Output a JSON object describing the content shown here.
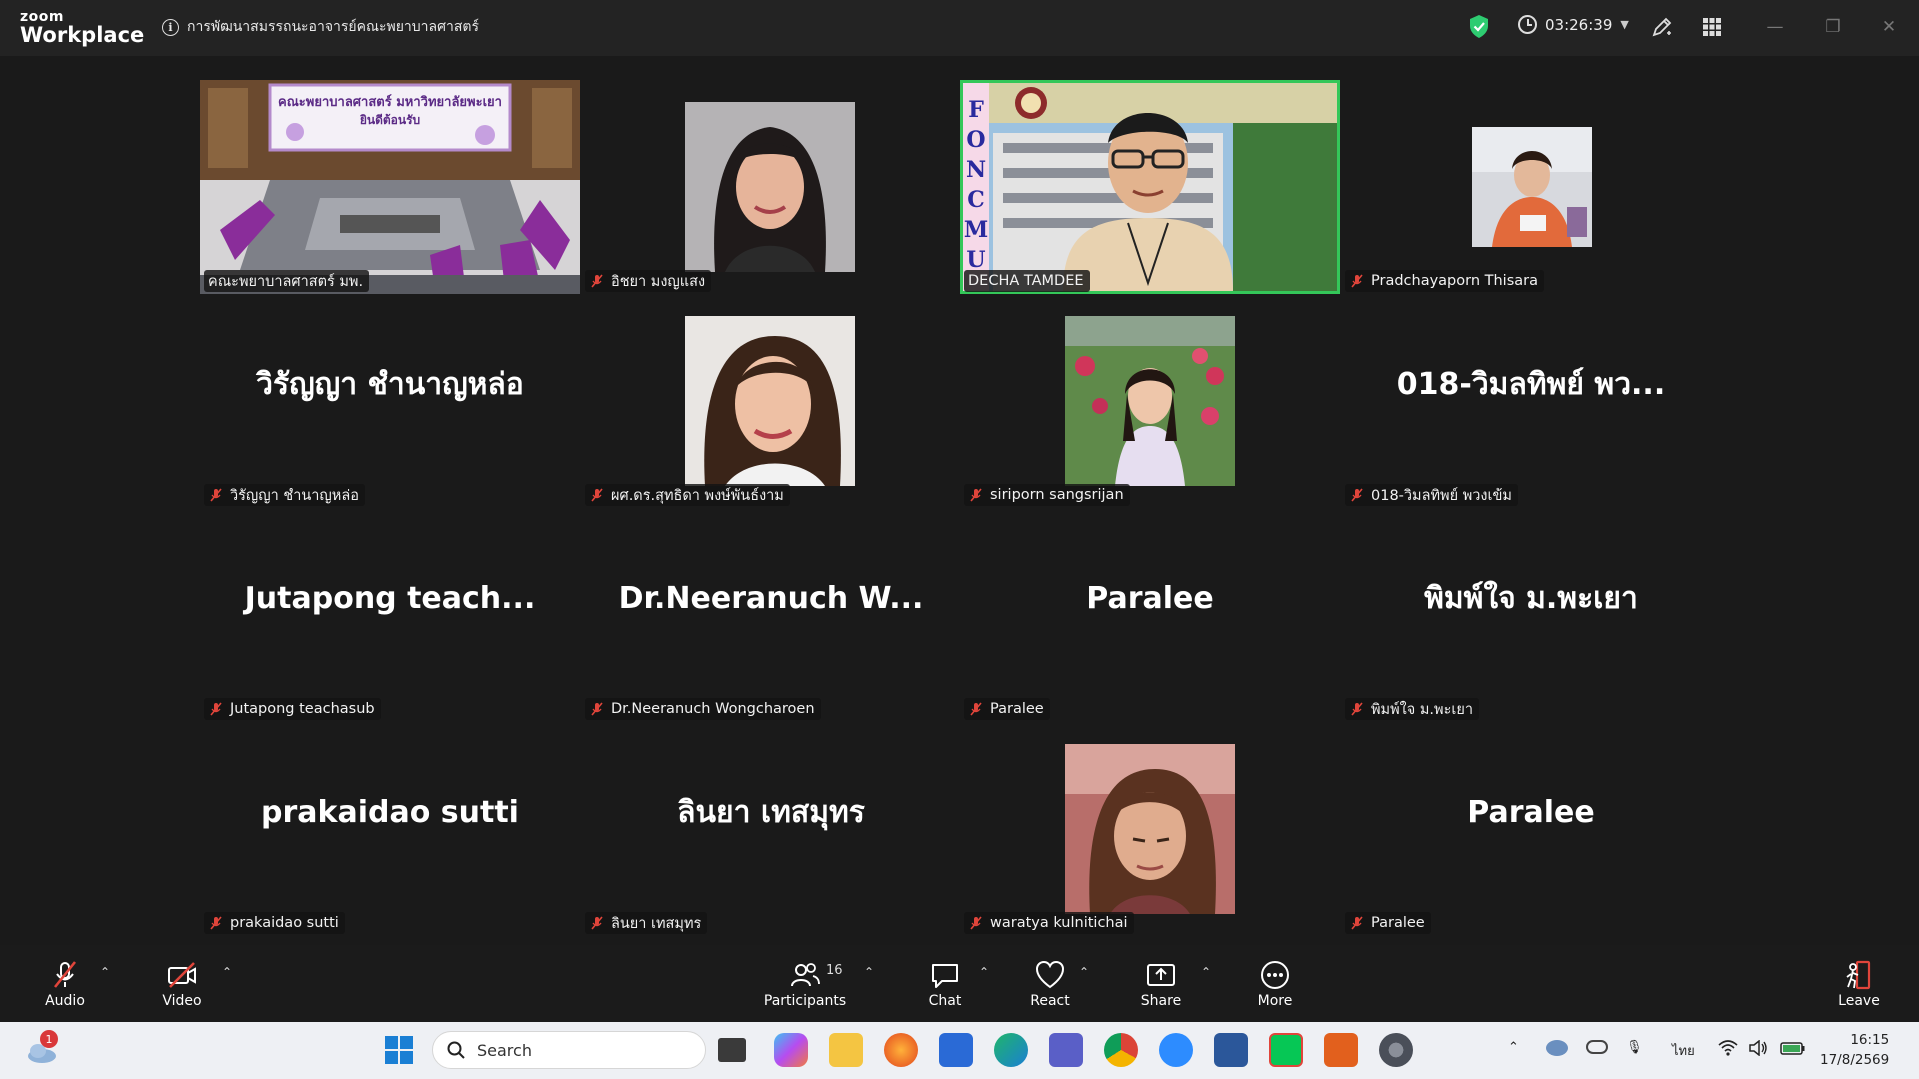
{
  "app": {
    "logo_line1": "zoom",
    "logo_line2": "Workplace"
  },
  "meeting": {
    "title": "การพัฒนาสมรรถนะอาจารย์คณะพยาบาลศาสตร์",
    "timer": "03:26:39"
  },
  "room_sign": {
    "line1": "คณะพยาบาลศาสตร์ มหาวิทยาลัยพะเยา",
    "line2": "ยินดีต้อนรับ"
  },
  "speaker_banner": "FONCMU",
  "participants": [
    {
      "name": "คณะพยาบาลศาสตร์ มพ.",
      "big": ""
    },
    {
      "name": "อิชยา มงญแสง",
      "big": ""
    },
    {
      "name": "DECHA TAMDEE",
      "big": ""
    },
    {
      "name": "Pradchayaporn Thisara",
      "big": ""
    },
    {
      "name": "วิรัญญา ชำนาญหล่อ",
      "big": "วิรัญญา ชำนาญหล่อ"
    },
    {
      "name": "ผศ.ดร.สุทธิดา พงษ์พันธ์งาม",
      "big": ""
    },
    {
      "name": "siriporn sangsrijan",
      "big": ""
    },
    {
      "name": "018-วิมลทิพย์ พวงเข้ม",
      "big": "018-วิมลทิพย์ พว..."
    },
    {
      "name": "Jutapong teachasub",
      "big": "Jutapong  teach..."
    },
    {
      "name": "Dr.Neeranuch Wongcharoen",
      "big": "Dr.Neeranuch  W..."
    },
    {
      "name": "Paralee",
      "big": "Paralee"
    },
    {
      "name": "พิมพ์ใจ ม.พะเยา",
      "big": "พิมพ์ใจ ม.พะเยา"
    },
    {
      "name": "prakaidao sutti",
      "big": "prakaidao sutti"
    },
    {
      "name": "ลินยา เทสมุทร",
      "big": "ลินยา เทสมุทร"
    },
    {
      "name": "waratya kulnitichai",
      "big": ""
    },
    {
      "name": "Paralee",
      "big": "Paralee"
    }
  ],
  "toolbar": {
    "audio": "Audio",
    "video": "Video",
    "participants": "Participants",
    "participant_count": "16",
    "chat": "Chat",
    "react": "React",
    "share": "Share",
    "more": "More",
    "leave": "Leave"
  },
  "taskbar": {
    "search_placeholder": "Search",
    "notification_count": "1",
    "language": "ไทย",
    "time": "16:15",
    "date": "17/8/2569"
  },
  "colors": {
    "active_speaker": "#34c759",
    "mute": "#e0453b",
    "leave": "#e0453b",
    "security": "#2ecc71"
  }
}
